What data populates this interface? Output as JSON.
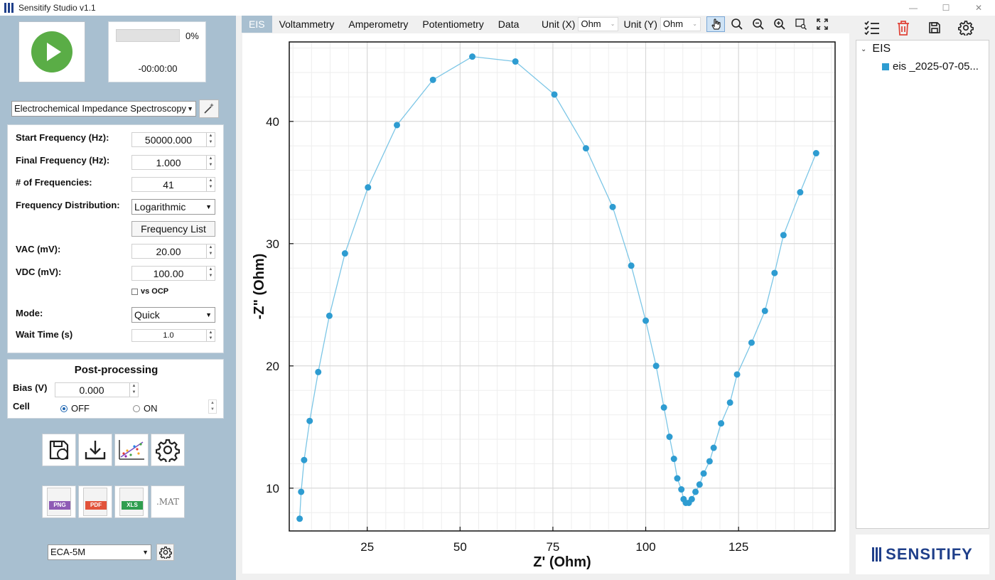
{
  "window": {
    "title": "Sensitify Studio v1.1"
  },
  "run": {
    "progress_label": "0%",
    "progress_fraction": 0,
    "elapsed": "-00:00:00"
  },
  "method": {
    "selected": "Electrochemical Impedance Spectroscopy"
  },
  "params": {
    "start_freq_label": "Start Frequency (Hz):",
    "start_freq": "50000.000",
    "final_freq_label": "Final Frequency (Hz):",
    "final_freq": "1.000",
    "num_freq_label": "# of Frequencies:",
    "num_freq": "41",
    "freq_dist_label": "Frequency Distribution:",
    "freq_dist": "Logarithmic",
    "freq_list_button": "Frequency List",
    "vac_label": "VAC (mV):",
    "vac": "20.00",
    "vdc_label": "VDC (mV):",
    "vdc": "100.00",
    "vs_ocp_label": "vs OCP",
    "mode_label": "Mode:",
    "mode": "Quick",
    "wait_label": "Wait Time (s)",
    "wait": "1.0"
  },
  "post": {
    "title": "Post-processing",
    "bias_label": "Bias (V)",
    "bias": "0.000",
    "cell_label": "Cell",
    "off_label": "OFF",
    "on_label": "ON",
    "selected": "OFF"
  },
  "file_buttons": {
    "png": "PNG",
    "pdf": "PDF",
    "xls": "XLS",
    "mat": ".MAT"
  },
  "device": {
    "selected": "ECA-5M"
  },
  "tabs": [
    "EIS",
    "Voltammetry",
    "Amperometry",
    "Potentiometry",
    "Data"
  ],
  "active_tab": "EIS",
  "units": {
    "x_label": "Unit (X)",
    "x_value": "Ohm",
    "y_label": "Unit (Y)",
    "y_value": "Ohm"
  },
  "tree": {
    "root": "EIS",
    "child": "eis _2025-07-05..."
  },
  "brand": {
    "name": "SENSITIFY"
  },
  "colors": {
    "accent": "#2e9cd1",
    "panel": "#a8bfd0",
    "brand": "#1f3f8a"
  },
  "chart_data": {
    "type": "scatter",
    "xlabel": "Z' (Ohm)",
    "ylabel": "-Z\" (Ohm)",
    "xlim": [
      4,
      151
    ],
    "ylim": [
      6.5,
      46.5
    ],
    "xticks": [
      25,
      50,
      75,
      100,
      125
    ],
    "yticks": [
      10,
      20,
      30,
      40
    ],
    "xtick_labels": [
      "25",
      "50",
      "75",
      "100",
      "125"
    ],
    "ytick_labels": [
      "10",
      "20",
      "30",
      "40"
    ],
    "grid": true,
    "series": [
      {
        "color": "#2e9cd1",
        "x": [
          6.8,
          7.2,
          8.0,
          9.5,
          11.8,
          14.8,
          19.0,
          25.2,
          33.0,
          42.7,
          53.3,
          64.9,
          75.4,
          83.9,
          91.1,
          96.1,
          100.0,
          102.8,
          104.9,
          106.4,
          107.6,
          108.5,
          109.6,
          110.2,
          110.8,
          111.6,
          112.4,
          113.4,
          114.5,
          115.6,
          117.2,
          118.3,
          120.3,
          122.7,
          124.6,
          128.5,
          132.1,
          134.7,
          137.1,
          141.6,
          145.9
        ],
        "y": [
          7.5,
          9.7,
          12.3,
          15.5,
          19.5,
          24.1,
          29.2,
          34.6,
          39.7,
          43.4,
          45.3,
          44.9,
          42.2,
          37.8,
          33.0,
          28.2,
          23.7,
          20.0,
          16.6,
          14.2,
          12.4,
          10.8,
          9.9,
          9.1,
          8.8,
          8.8,
          9.1,
          9.7,
          10.3,
          11.2,
          12.2,
          13.3,
          15.3,
          17.0,
          19.3,
          21.9,
          24.5,
          27.6,
          30.7,
          34.2,
          37.4
        ]
      }
    ]
  }
}
